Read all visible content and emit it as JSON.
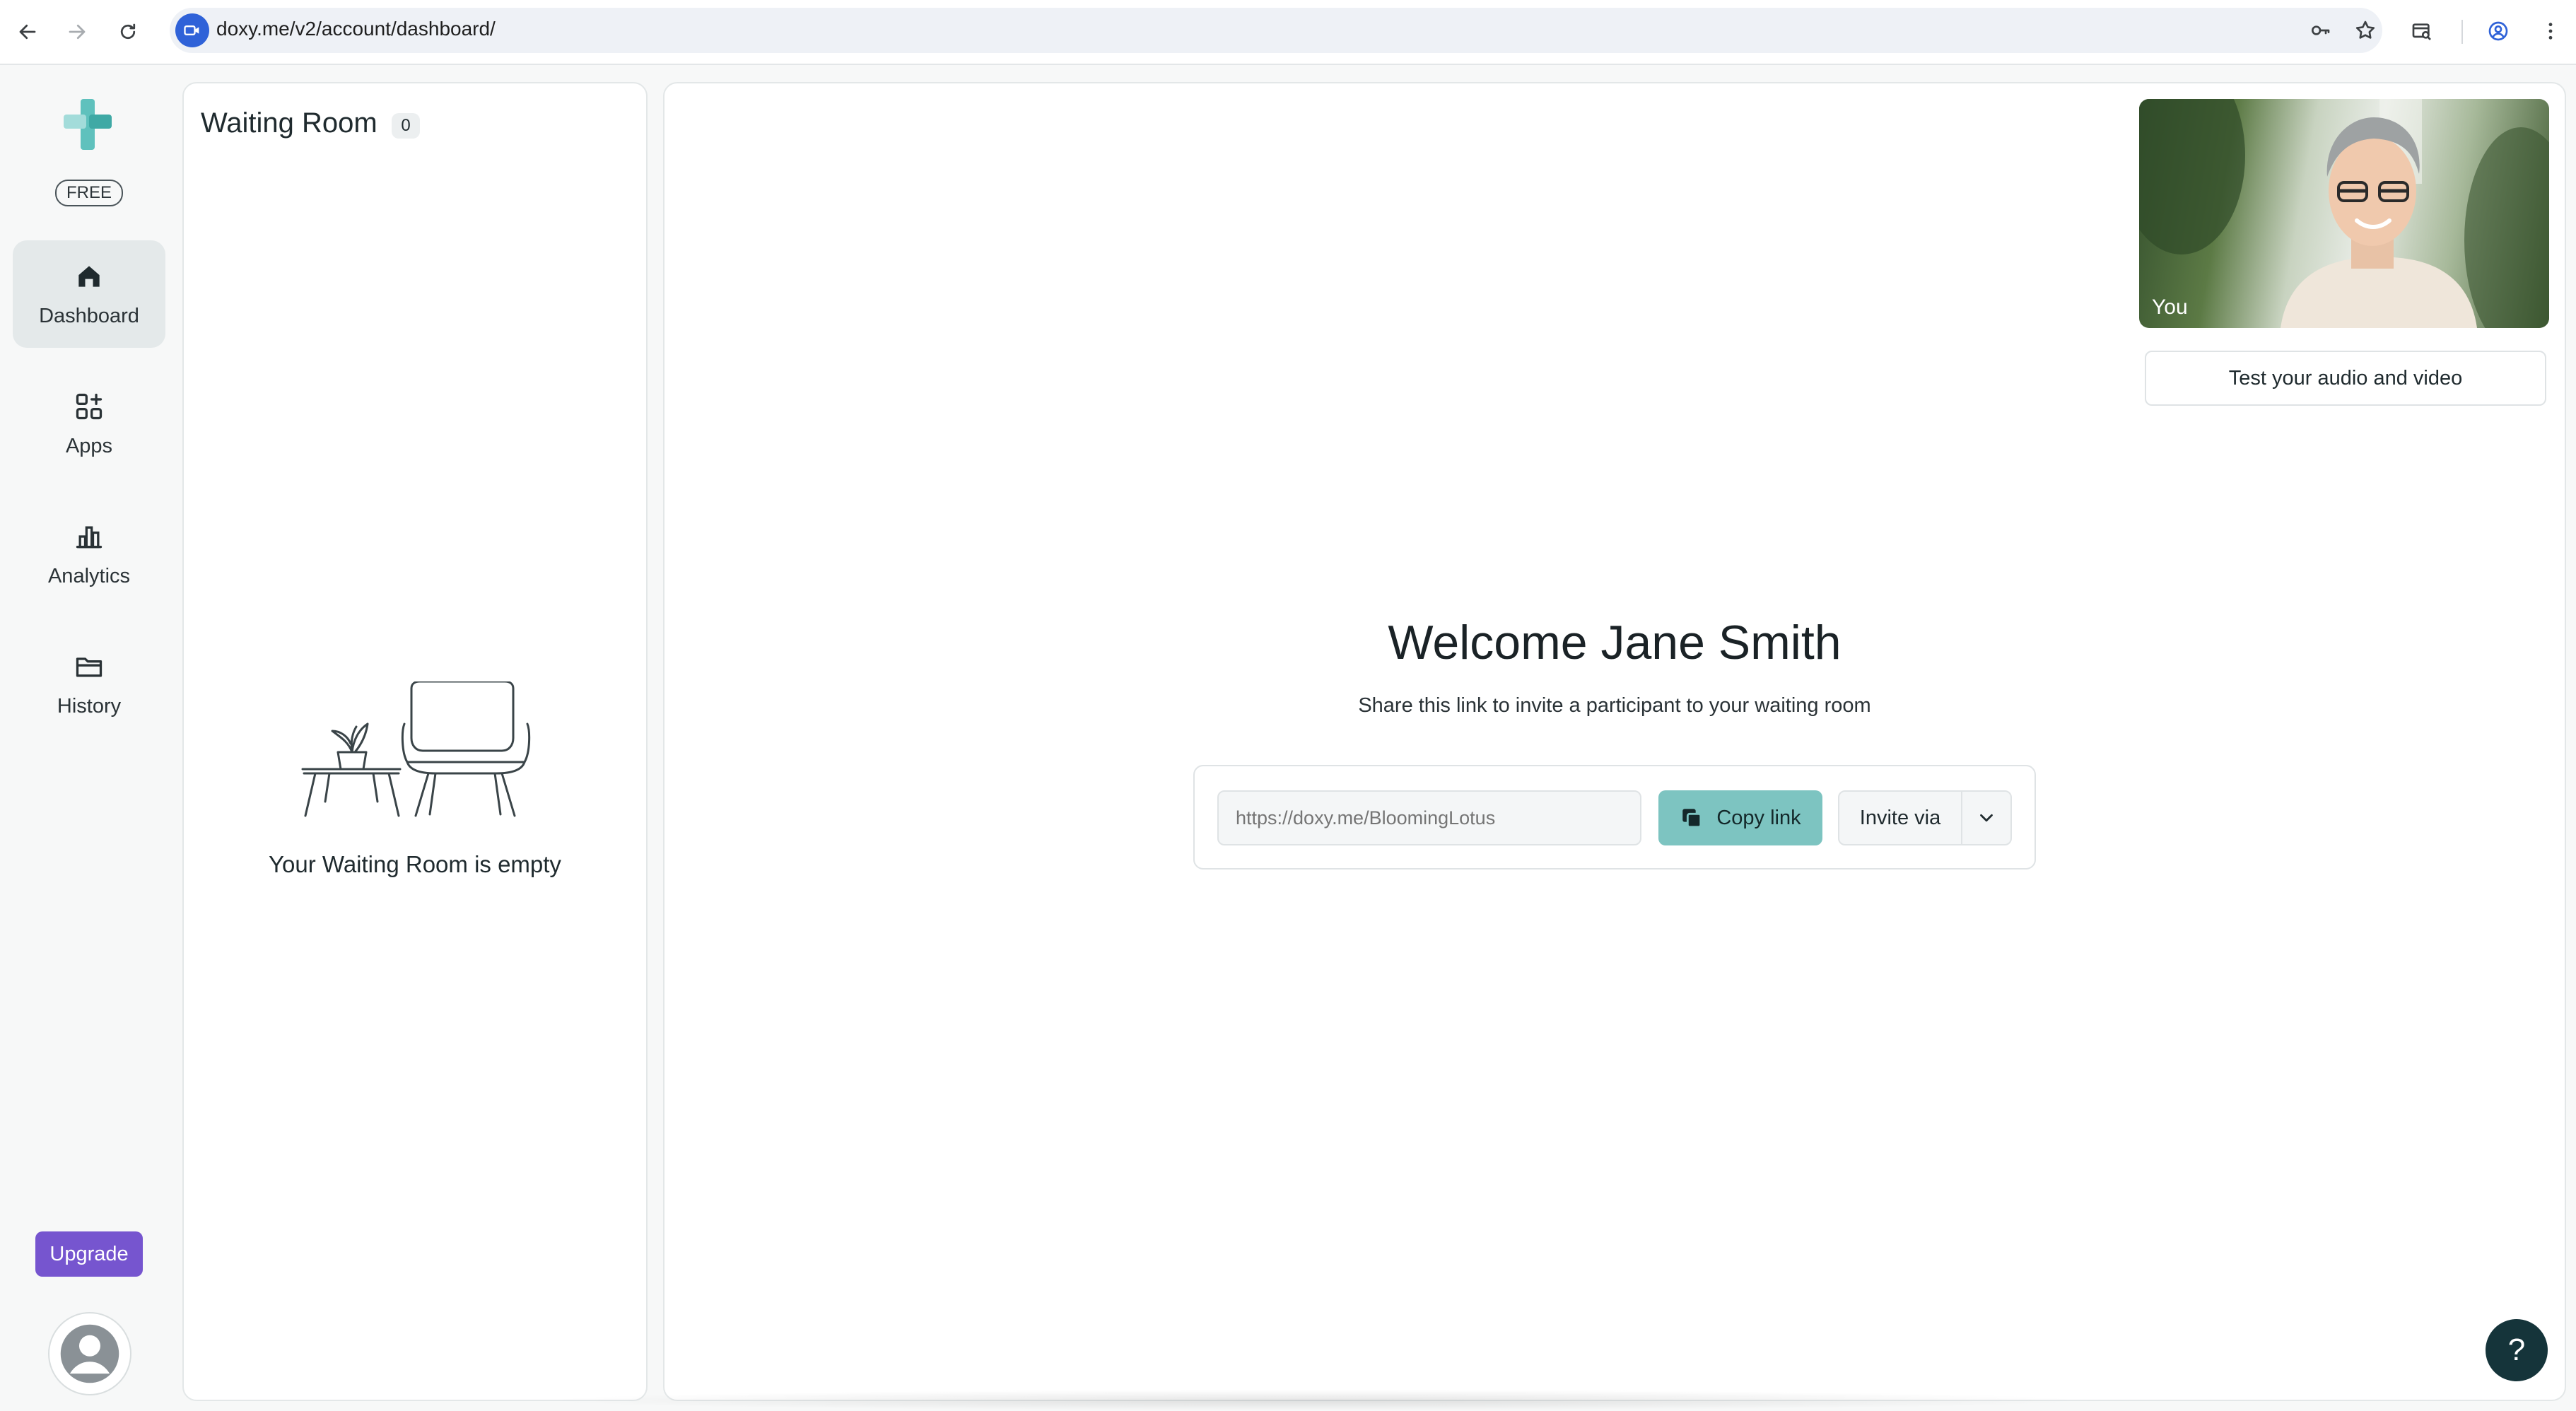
{
  "browser": {
    "url": "doxy.me/v2/account/dashboard/",
    "back_icon": "back-arrow-icon",
    "forward_icon": "forward-arrow-icon",
    "reload_icon": "reload-icon"
  },
  "sidebar": {
    "plan_badge": "FREE",
    "items": [
      {
        "label": "Dashboard",
        "icon": "home-icon",
        "active": true
      },
      {
        "label": "Apps",
        "icon": "apps-grid-icon",
        "active": false
      },
      {
        "label": "Analytics",
        "icon": "bar-chart-icon",
        "active": false
      },
      {
        "label": "History",
        "icon": "folder-icon",
        "active": false
      }
    ],
    "upgrade_label": "Upgrade"
  },
  "waiting_room": {
    "title": "Waiting Room",
    "count": "0",
    "empty_text": "Your Waiting Room is empty"
  },
  "main": {
    "self_video_label": "You",
    "test_av_label": "Test your audio and video",
    "welcome": "Welcome Jane Smith",
    "subtitle": "Share this link to invite a participant to your waiting room",
    "room_link_placeholder": "https://doxy.me/BloomingLotus",
    "copy_link_label": "Copy link",
    "invite_label": "Invite via",
    "help_label": "?"
  },
  "colors": {
    "brand_teal": "#7dc4c1",
    "upgrade_purple": "#7655cf",
    "help_dark": "#15343a"
  }
}
